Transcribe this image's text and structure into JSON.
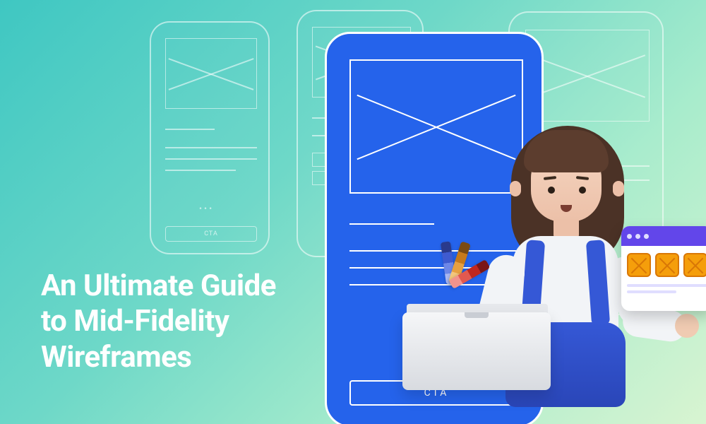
{
  "title_line1": "An Ultimate Guide",
  "title_line2": "to Mid-Fidelity",
  "title_line3": "Wireframes",
  "ghost_cta_label": "CTA",
  "main_cta_label": "CTA"
}
